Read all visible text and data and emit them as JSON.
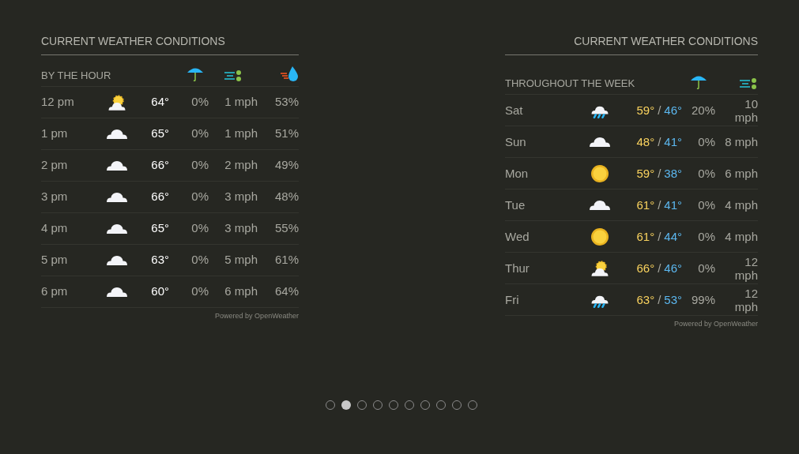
{
  "hourly": {
    "title": "CURRENT WEATHER CONDITIONS",
    "subtitle": "BY THE HOUR",
    "rows": [
      {
        "time": "12 pm",
        "kind": "partly-cloudy",
        "temp": "64°",
        "precip": "0%",
        "wind": "1 mph",
        "humidity": "53%"
      },
      {
        "time": "1 pm",
        "kind": "cloudy",
        "temp": "65°",
        "precip": "0%",
        "wind": "1 mph",
        "humidity": "51%"
      },
      {
        "time": "2 pm",
        "kind": "cloudy",
        "temp": "66°",
        "precip": "0%",
        "wind": "2 mph",
        "humidity": "49%"
      },
      {
        "time": "3 pm",
        "kind": "cloudy",
        "temp": "66°",
        "precip": "0%",
        "wind": "3 mph",
        "humidity": "48%"
      },
      {
        "time": "4 pm",
        "kind": "cloudy",
        "temp": "65°",
        "precip": "0%",
        "wind": "3 mph",
        "humidity": "55%"
      },
      {
        "time": "5 pm",
        "kind": "cloudy",
        "temp": "63°",
        "precip": "0%",
        "wind": "5 mph",
        "humidity": "61%"
      },
      {
        "time": "6 pm",
        "kind": "cloudy",
        "temp": "60°",
        "precip": "0%",
        "wind": "6 mph",
        "humidity": "64%"
      }
    ],
    "credit": "Powered by OpenWeather"
  },
  "weekly": {
    "title": "CURRENT WEATHER CONDITIONS",
    "subtitle": "THROUGHOUT THE WEEK",
    "rows": [
      {
        "day": "Sat",
        "kind": "rain",
        "high": "59°",
        "low": "46°",
        "precip": "20%",
        "wind": "10 mph"
      },
      {
        "day": "Sun",
        "kind": "cloudy",
        "high": "48°",
        "low": "41°",
        "precip": "0%",
        "wind": "8 mph"
      },
      {
        "day": "Mon",
        "kind": "sunny",
        "high": "59°",
        "low": "38°",
        "precip": "0%",
        "wind": "6 mph"
      },
      {
        "day": "Tue",
        "kind": "cloudy",
        "high": "61°",
        "low": "41°",
        "precip": "0%",
        "wind": "4 mph"
      },
      {
        "day": "Wed",
        "kind": "sunny",
        "high": "61°",
        "low": "44°",
        "precip": "0%",
        "wind": "4 mph"
      },
      {
        "day": "Thur",
        "kind": "partly-cloudy",
        "high": "66°",
        "low": "46°",
        "precip": "0%",
        "wind": "12 mph"
      },
      {
        "day": "Fri",
        "kind": "rain",
        "high": "63°",
        "low": "53°",
        "precip": "99%",
        "wind": "12 mph"
      }
    ],
    "separator": "/",
    "credit": "Powered by OpenWeather"
  },
  "pager": [
    {
      "selected": false
    },
    {
      "selected": true
    },
    {
      "selected": false
    },
    {
      "selected": false
    },
    {
      "selected": false
    },
    {
      "selected": false
    },
    {
      "selected": false
    },
    {
      "selected": false
    },
    {
      "selected": false
    },
    {
      "selected": false
    }
  ]
}
